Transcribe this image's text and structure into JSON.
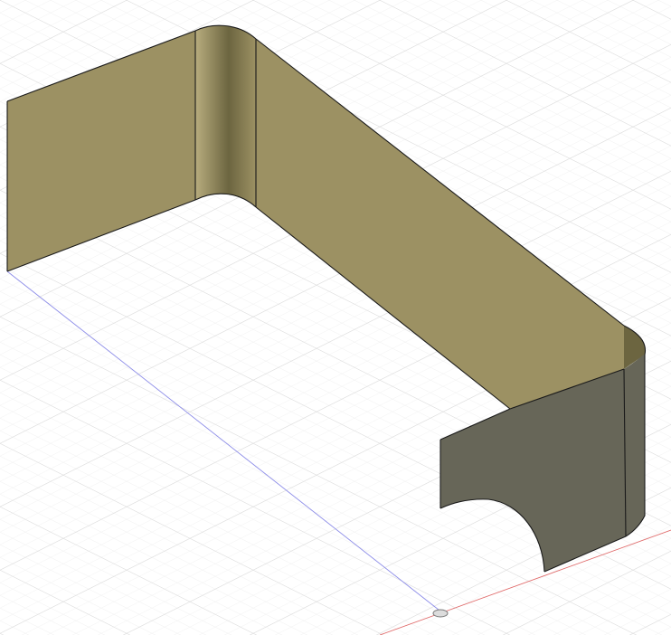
{
  "viewport": {
    "background": "#ffffff",
    "grid_minor_color": "#e6e6e6",
    "grid_major_color": "#d2d2d2",
    "axis_x_color": "#e06a6a",
    "axis_y_color": "#8c8ce8",
    "origin_marker": "origin-icon"
  },
  "model": {
    "name": "",
    "outline_color": "#1a1a1a",
    "face_front_color": "#9c9163",
    "face_back_color": "#676658",
    "highlight_color": "#b8ad7e",
    "shadow_color": "#6c6540"
  }
}
